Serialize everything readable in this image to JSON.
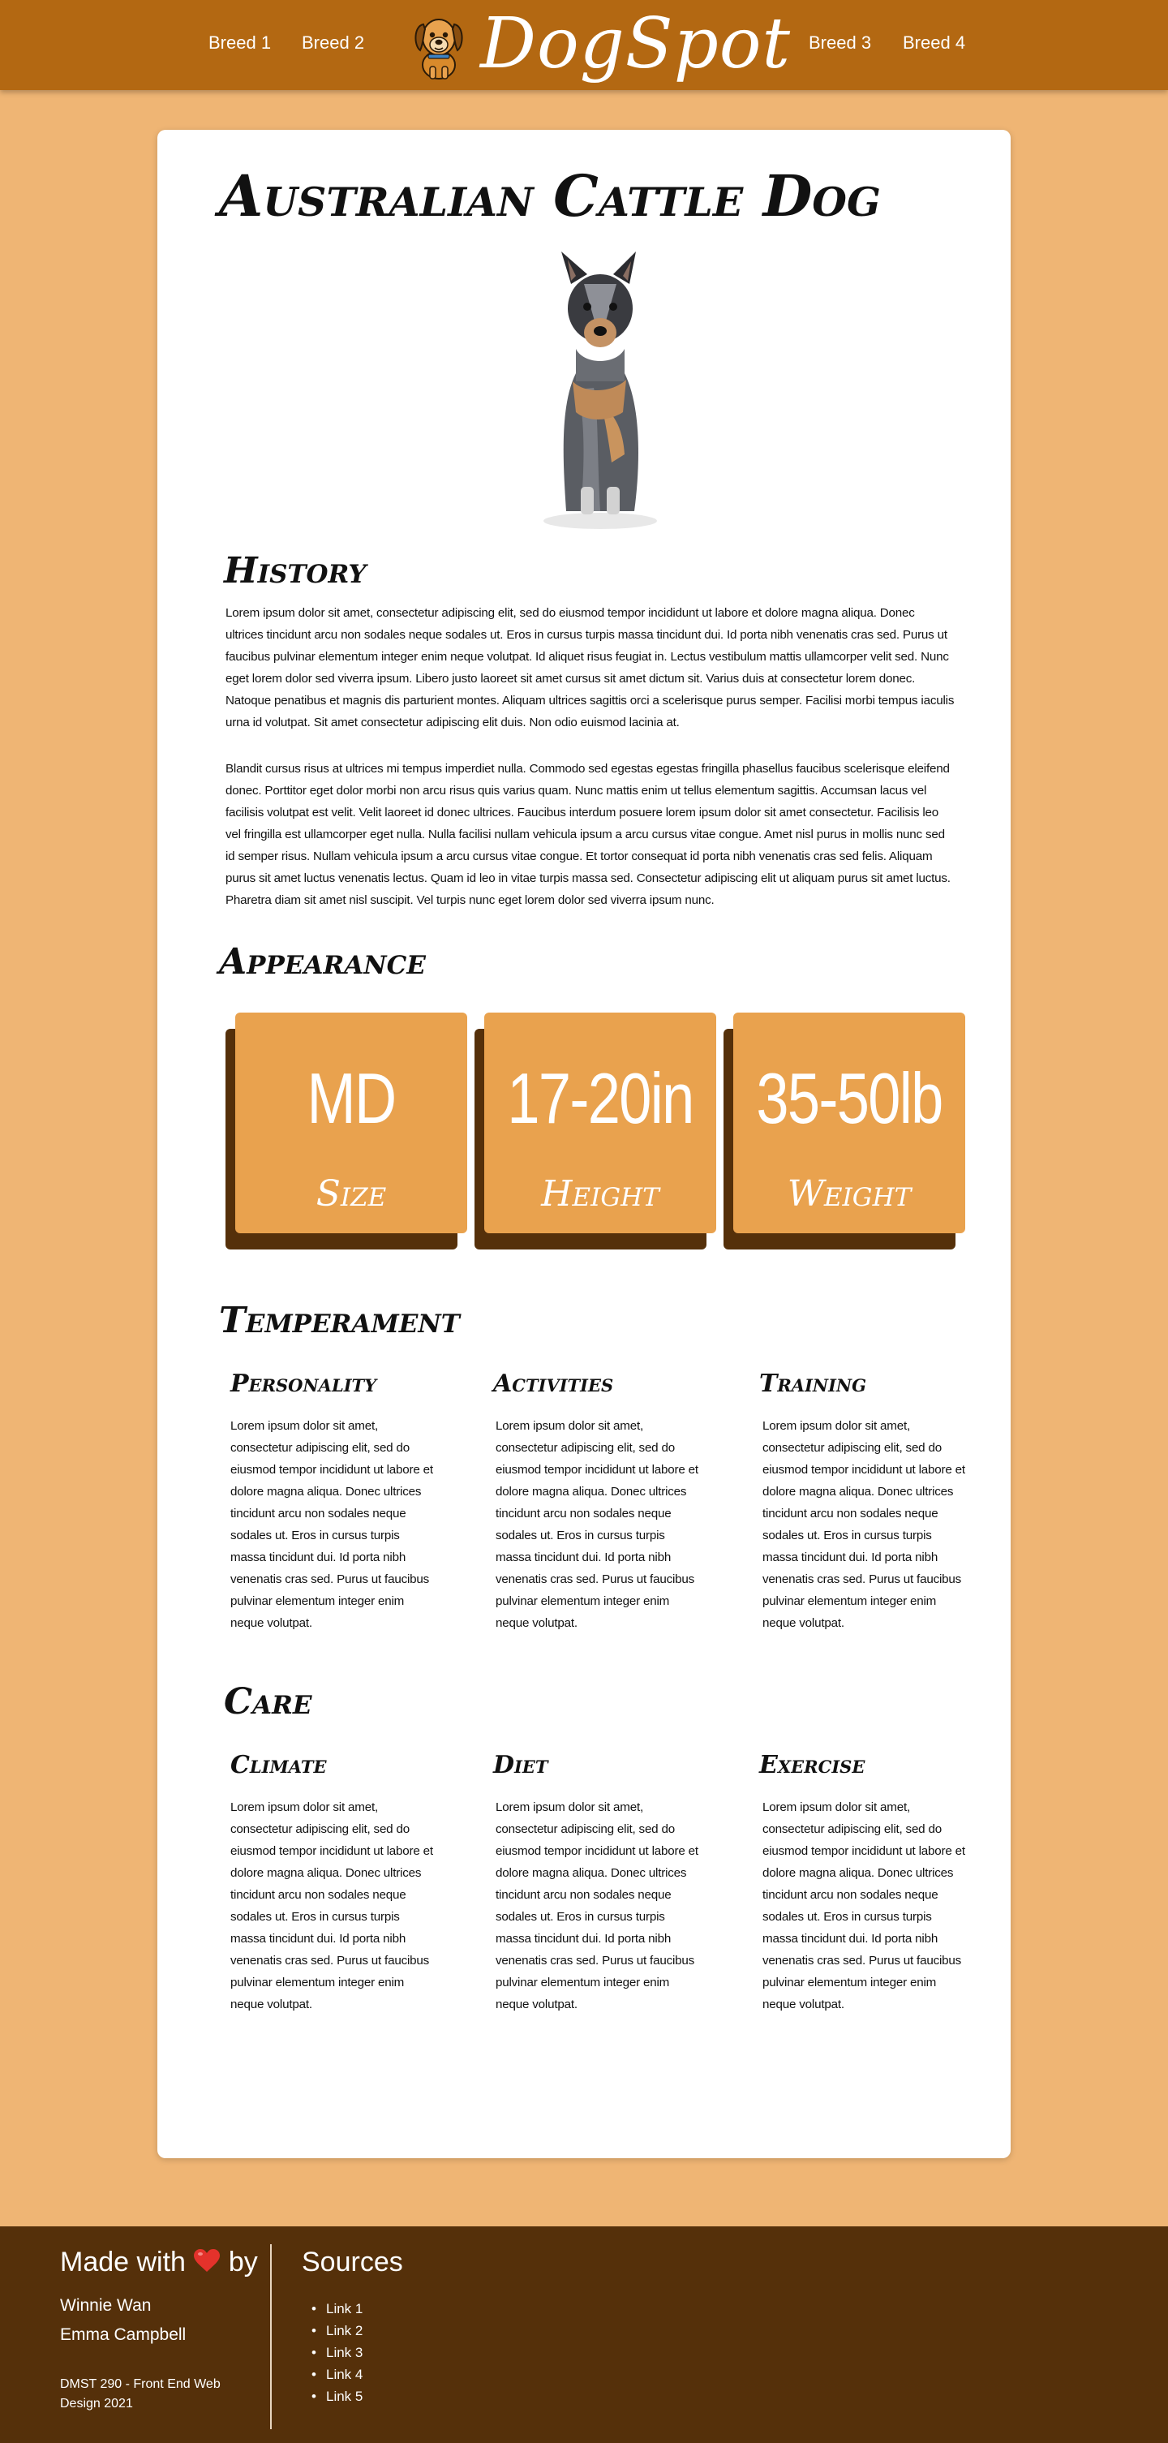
{
  "nav": {
    "links_left": [
      "Breed 1",
      "Breed 2"
    ],
    "brand": "DogSpot",
    "links_right": [
      "Breed 3",
      "Breed 4"
    ]
  },
  "page": {
    "title": "Australian Cattle Dog"
  },
  "history": {
    "heading": "History",
    "paragraphs": [
      "Lorem ipsum dolor sit amet, consectetur adipiscing elit, sed do eiusmod tempor incididunt ut labore et dolore magna aliqua. Donec ultrices tincidunt arcu non sodales neque sodales ut. Eros in cursus turpis massa tincidunt dui. Id porta nibh venenatis cras sed. Purus ut faucibus pulvinar elementum integer enim neque volutpat. Id aliquet risus feugiat in. Lectus vestibulum mattis ullamcorper velit sed. Nunc eget lorem dolor sed viverra ipsum. Libero justo laoreet sit amet cursus sit amet dictum sit. Varius duis at consectetur lorem donec. Natoque penatibus et magnis dis parturient montes. Aliquam ultrices sagittis orci a scelerisque purus semper. Facilisi morbi tempus iaculis urna id volutpat. Sit amet consectetur adipiscing elit duis. Non odio euismod lacinia at.",
      "Blandit cursus risus at ultrices mi tempus imperdiet nulla. Commodo sed egestas egestas fringilla phasellus faucibus scelerisque eleifend donec. Porttitor eget dolor morbi non arcu risus quis varius quam. Nunc mattis enim ut tellus elementum sagittis. Accumsan lacus vel facilisis volutpat est velit. Velit laoreet id donec ultrices. Faucibus interdum posuere lorem ipsum dolor sit amet consectetur. Facilisis leo vel fringilla est ullamcorper eget nulla. Nulla facilisi nullam vehicula ipsum a arcu cursus vitae congue. Amet nisl purus in mollis nunc sed id semper risus. Nullam vehicula ipsum a arcu cursus vitae congue. Et tortor consequat id porta nibh venenatis cras sed felis. Aliquam purus sit amet luctus venenatis lectus. Quam id leo in vitae turpis massa sed. Consectetur adipiscing elit ut aliquam purus sit amet luctus. Pharetra diam sit amet nisl suscipit. Vel turpis nunc eget lorem dolor sed viverra ipsum nunc."
    ]
  },
  "appearance": {
    "heading": "Appearance",
    "stats": [
      {
        "value": "MD",
        "label": "Size"
      },
      {
        "value": "17-20in",
        "label": "Height"
      },
      {
        "value": "35-50lb",
        "label": "Weight"
      }
    ]
  },
  "temperament": {
    "heading": "Temperament",
    "columns": [
      {
        "heading": "Personality",
        "text": "Lorem ipsum dolor sit amet, consectetur adipiscing elit, sed do eiusmod tempor incididunt ut labore et dolore magna aliqua. Donec ultrices tincidunt arcu non sodales neque sodales ut. Eros in cursus turpis massa tincidunt dui. Id porta nibh venenatis cras sed. Purus ut faucibus pulvinar elementum integer enim neque volutpat."
      },
      {
        "heading": "Activities",
        "text": "Lorem ipsum dolor sit amet, consectetur adipiscing elit, sed do eiusmod tempor incididunt ut labore et dolore magna aliqua. Donec ultrices tincidunt arcu non sodales neque sodales ut. Eros in cursus turpis massa tincidunt dui. Id porta nibh venenatis cras sed. Purus ut faucibus pulvinar elementum integer enim neque volutpat."
      },
      {
        "heading": "Training",
        "text": "Lorem ipsum dolor sit amet, consectetur adipiscing elit, sed do eiusmod tempor incididunt ut labore et dolore magna aliqua. Donec ultrices tincidunt arcu non sodales neque sodales ut. Eros in cursus turpis massa tincidunt dui. Id porta nibh venenatis cras sed. Purus ut faucibus pulvinar elementum integer enim neque volutpat."
      }
    ]
  },
  "care": {
    "heading": "Care",
    "columns": [
      {
        "heading": "Climate",
        "text": "Lorem ipsum dolor sit amet, consectetur adipiscing elit, sed do eiusmod tempor incididunt ut labore et dolore magna aliqua. Donec ultrices tincidunt arcu non sodales neque sodales ut. Eros in cursus turpis massa tincidunt dui. Id porta nibh venenatis cras sed. Purus ut faucibus pulvinar elementum integer enim neque volutpat."
      },
      {
        "heading": "Diet",
        "text": "Lorem ipsum dolor sit amet, consectetur adipiscing elit, sed do eiusmod tempor incididunt ut labore et dolore magna aliqua. Donec ultrices tincidunt arcu non sodales neque sodales ut. Eros in cursus turpis massa tincidunt dui. Id porta nibh venenatis cras sed. Purus ut faucibus pulvinar elementum integer enim neque volutpat."
      },
      {
        "heading": "Exercise",
        "text": "Lorem ipsum dolor sit amet, consectetur adipiscing elit, sed do eiusmod tempor incididunt ut labore et dolore magna aliqua. Donec ultrices tincidunt arcu non sodales neque sodales ut. Eros in cursus turpis massa tincidunt dui. Id porta nibh venenatis cras sed. Purus ut faucibus pulvinar elementum integer enim neque volutpat."
      }
    ]
  },
  "footer": {
    "made_with": "Made with",
    "by": "by",
    "authors": [
      "Winnie Wan",
      "Emma Campbell"
    ],
    "course": "DMST 290 - Front End Web Design 2021",
    "sources_heading": "Sources",
    "sources": [
      "Link 1",
      "Link 2",
      "Link 3",
      "Link 4",
      "Link 5"
    ]
  },
  "icons": {
    "logo": "dog-face-icon",
    "heart": "heart-icon"
  },
  "colors": {
    "nav_bg": "#b36812",
    "page_bg": "#efb574",
    "stat_box": "#e9a24e",
    "stat_shadow": "#55300a",
    "footer_bg": "#55300a"
  }
}
